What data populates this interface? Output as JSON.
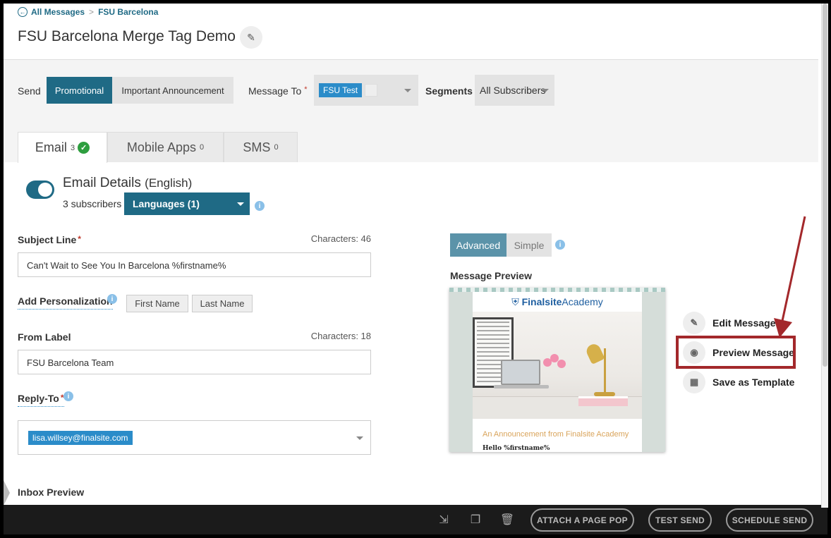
{
  "breadcrumb": {
    "back_label": "All Messages",
    "separator": ">",
    "current": "FSU Barcelona"
  },
  "page": {
    "title": "FSU Barcelona Merge Tag Demo"
  },
  "send_bar": {
    "send_label": "Send",
    "promotional_label": "Promotional",
    "important_label": "Important Announcement",
    "message_to_label": "Message To",
    "required_mark": "*",
    "message_to_chip": "FSU Test",
    "segments_label": "Segments",
    "segments_value": "All Subscribers"
  },
  "tabs": [
    {
      "label": "Email",
      "count": "3",
      "active": true
    },
    {
      "label": "Mobile Apps",
      "count": "0",
      "active": false
    },
    {
      "label": "SMS",
      "count": "0",
      "active": false
    }
  ],
  "email_details": {
    "title": "Email Details",
    "language_note": "(English)",
    "subscribers": "3 subscribers",
    "languages_select": "Languages (1)"
  },
  "form": {
    "subject_label": "Subject Line",
    "subject_chars": "Characters: 46",
    "subject_value": "Can't Wait to See You In Barcelona %firstname%",
    "personalization_label": "Add Personalization",
    "first_name_btn": "First Name",
    "last_name_btn": "Last Name",
    "from_label": "From Label",
    "from_chars": "Characters: 18",
    "from_value": "FSU Barcelona Team",
    "reply_to_label": "Reply-To",
    "reply_to_chip": "lisa.willsey@finalsite.com"
  },
  "preview": {
    "advanced_label": "Advanced",
    "simple_label": "Simple",
    "message_preview_label": "Message Preview",
    "logo_bold": "Finalsite",
    "logo_light": "Academy",
    "announcement": "An Announcement from Finalsite Academy",
    "hello": "Hello %firstname%"
  },
  "actions": {
    "edit": "Edit Message",
    "preview": "Preview Message",
    "save_template": "Save as Template"
  },
  "inbox_preview_label": "Inbox Preview",
  "bottom_bar": {
    "attach_label": "ATTACH A PAGE POP",
    "test_send_label": "TEST SEND",
    "schedule_send_label": "SCHEDULE SEND"
  },
  "colors": {
    "brand_teal": "#1f6a85",
    "chip_blue": "#2b8cc9",
    "highlight_red": "#a3282b",
    "success_green": "#2e9e3f"
  }
}
